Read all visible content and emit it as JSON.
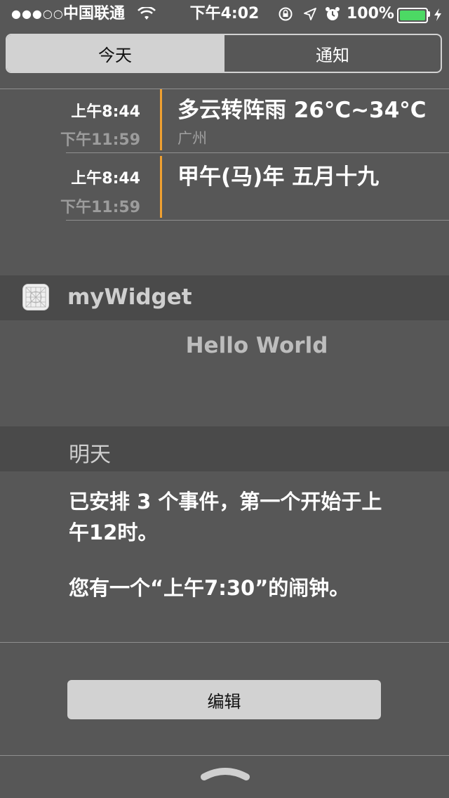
{
  "status_bar": {
    "signal": "●●●○○",
    "carrier": "中国联通",
    "time": "下午4:02",
    "battery": "100%",
    "battery_color": "#4cd964"
  },
  "tabs": [
    {
      "label": "今天",
      "active": true
    },
    {
      "label": "通知",
      "active": false
    }
  ],
  "events": [
    {
      "start": "上午8:44",
      "end": "下午11:59",
      "title": "多云转阵雨 26°C~34°C",
      "location": "广州",
      "accent": "#f0a030"
    },
    {
      "start": "上午8:44",
      "end": "下午11:59",
      "title": "甲午(马)年 五月十九",
      "location": "",
      "accent": "#f0a030"
    }
  ],
  "widget": {
    "icon": "app-icon",
    "title": "myWidget",
    "content": "Hello World"
  },
  "tomorrow": {
    "title": "明天",
    "summary_line1": "已安排 3 个事件，第一个开始于上",
    "summary_line2": "午12时。",
    "alarm": "您有一个“上午7:30”的闹钟。"
  },
  "edit_label": "编辑"
}
